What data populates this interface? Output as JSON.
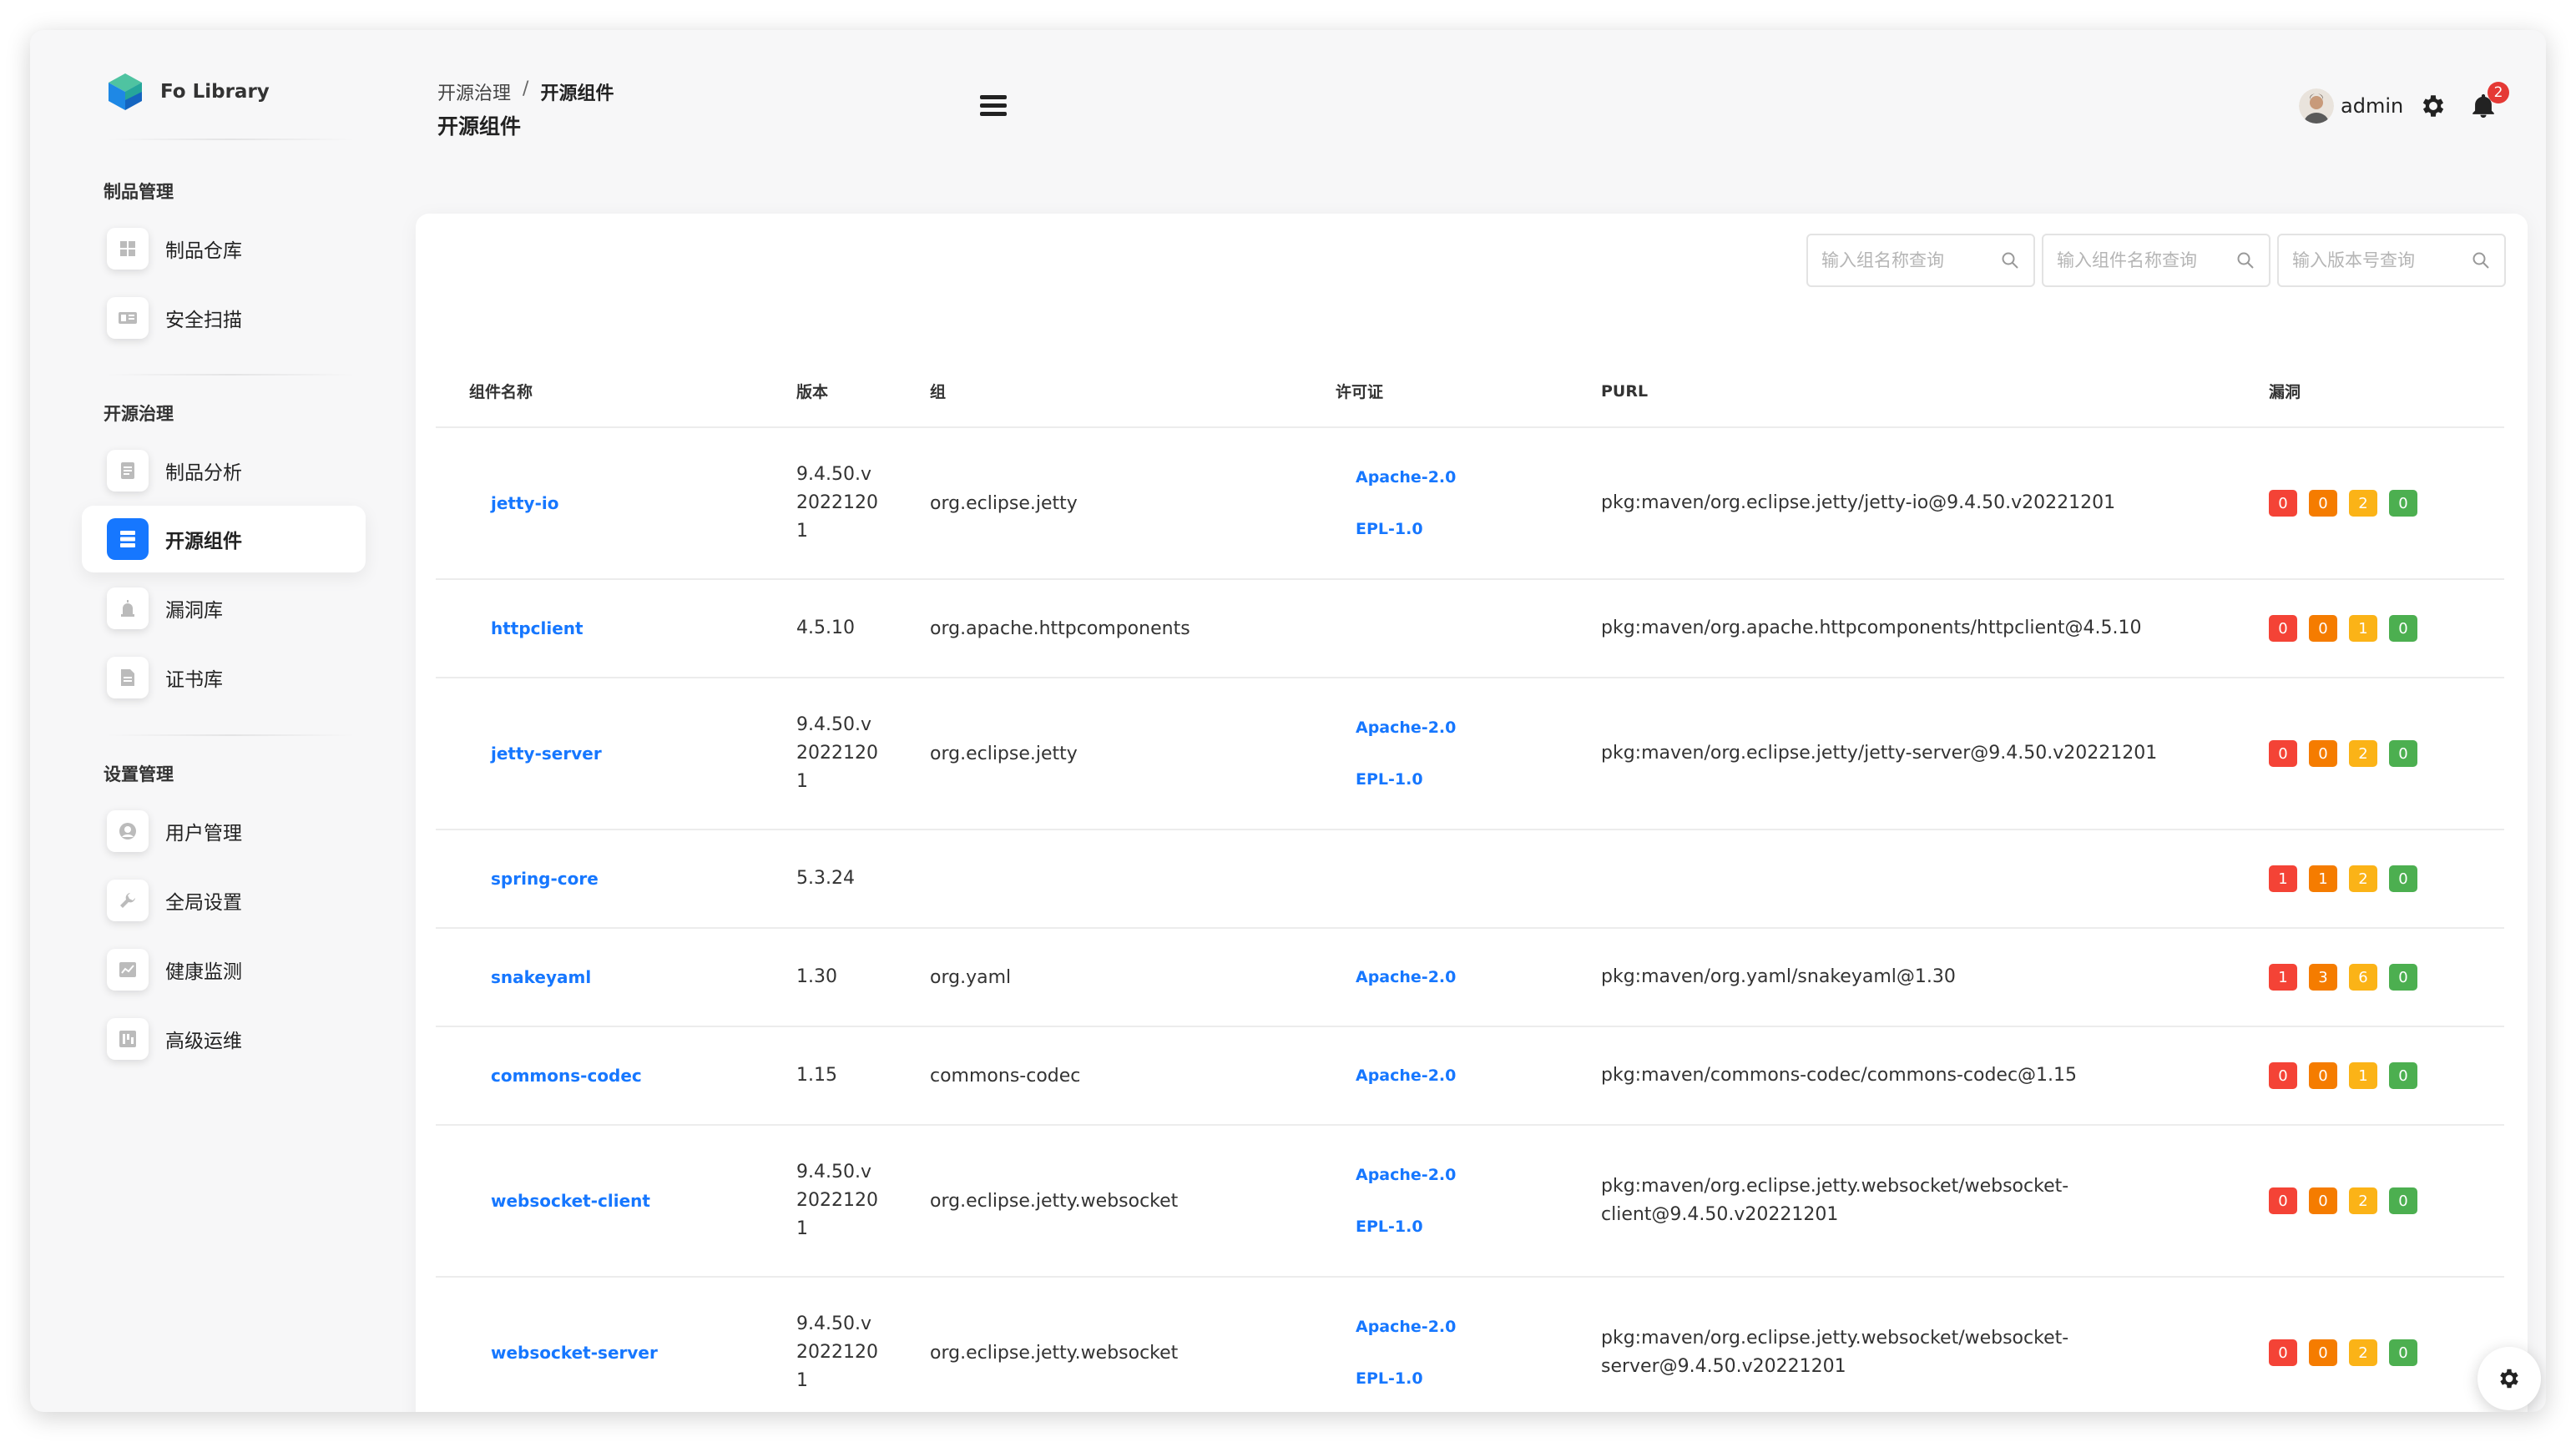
{
  "app": {
    "name": "Fo Library",
    "accent_color": "#1677ff",
    "logo_icon": "cube-logo-icon"
  },
  "sidebar": {
    "sections": [
      {
        "title": "制品管理",
        "items": [
          {
            "label": "制品仓库",
            "icon": "grid-icon",
            "active": false
          },
          {
            "label": "安全扫描",
            "icon": "scan-icon",
            "active": false
          }
        ]
      },
      {
        "title": "开源治理",
        "items": [
          {
            "label": "制品分析",
            "icon": "document-icon",
            "active": false
          },
          {
            "label": "开源组件",
            "icon": "list-icon",
            "active": true
          },
          {
            "label": "漏洞库",
            "icon": "alarm-icon",
            "active": false
          },
          {
            "label": "证书库",
            "icon": "certificate-icon",
            "active": false
          }
        ]
      },
      {
        "title": "设置管理",
        "items": [
          {
            "label": "用户管理",
            "icon": "user-icon",
            "active": false
          },
          {
            "label": "全局设置",
            "icon": "wrench-icon",
            "active": false
          },
          {
            "label": "健康监测",
            "icon": "chart-icon",
            "active": false
          },
          {
            "label": "高级运维",
            "icon": "server-icon",
            "active": false
          }
        ]
      }
    ]
  },
  "header": {
    "breadcrumb": [
      "开源治理",
      "开源组件"
    ],
    "separator": "/",
    "title": "开源组件",
    "user": "admin",
    "notification_count": "2"
  },
  "search": {
    "group_placeholder": "输入组名称查询",
    "component_placeholder": "输入组件名称查询",
    "version_placeholder": "输入版本号查询"
  },
  "table": {
    "columns": [
      "组件名称",
      "版本",
      "组",
      "许可证",
      "PURL",
      "漏洞"
    ],
    "severity_colors": {
      "critical": "#f44336",
      "high": "#f57c00",
      "medium": "#fbb317",
      "low": "#4caf50"
    },
    "rows": [
      {
        "name": "jetty-io",
        "version": "9.4.50.v20221201",
        "group": "org.eclipse.jetty",
        "licenses": [
          "Apache-2.0",
          "EPL-1.0"
        ],
        "purl": "pkg:maven/org.eclipse.jetty/jetty-io@9.4.50.v20221201",
        "vulns": [
          "0",
          "0",
          "2",
          "0"
        ]
      },
      {
        "name": "httpclient",
        "version": "4.5.10",
        "group": "org.apache.httpcomponents",
        "licenses": [],
        "purl": "pkg:maven/org.apache.httpcomponents/httpclient@4.5.10",
        "vulns": [
          "0",
          "0",
          "1",
          "0"
        ]
      },
      {
        "name": "jetty-server",
        "version": "9.4.50.v20221201",
        "group": "org.eclipse.jetty",
        "licenses": [
          "Apache-2.0",
          "EPL-1.0"
        ],
        "purl": "pkg:maven/org.eclipse.jetty/jetty-server@9.4.50.v20221201",
        "vulns": [
          "0",
          "0",
          "2",
          "0"
        ]
      },
      {
        "name": "spring-core",
        "version": "5.3.24",
        "group": "",
        "licenses": [],
        "purl": "",
        "vulns": [
          "1",
          "1",
          "2",
          "0"
        ]
      },
      {
        "name": "snakeyaml",
        "version": "1.30",
        "group": "org.yaml",
        "licenses": [
          "Apache-2.0"
        ],
        "purl": "pkg:maven/org.yaml/snakeyaml@1.30",
        "vulns": [
          "1",
          "3",
          "6",
          "0"
        ]
      },
      {
        "name": "commons-codec",
        "version": "1.15",
        "group": "commons-codec",
        "licenses": [
          "Apache-2.0"
        ],
        "purl": "pkg:maven/commons-codec/commons-codec@1.15",
        "vulns": [
          "0",
          "0",
          "1",
          "0"
        ]
      },
      {
        "name": "websocket-client",
        "version": "9.4.50.v20221201",
        "group": "org.eclipse.jetty.websocket",
        "licenses": [
          "Apache-2.0",
          "EPL-1.0"
        ],
        "purl": "pkg:maven/org.eclipse.jetty.websocket/websocket-client@9.4.50.v20221201",
        "vulns": [
          "0",
          "0",
          "2",
          "0"
        ]
      },
      {
        "name": "websocket-server",
        "version": "9.4.50.v20221201",
        "group": "org.eclipse.jetty.websocket",
        "licenses": [
          "Apache-2.0",
          "EPL-1.0"
        ],
        "purl": "pkg:maven/org.eclipse.jetty.websocket/websocket-server@9.4.50.v20221201",
        "vulns": [
          "0",
          "0",
          "2",
          "0"
        ]
      }
    ]
  }
}
